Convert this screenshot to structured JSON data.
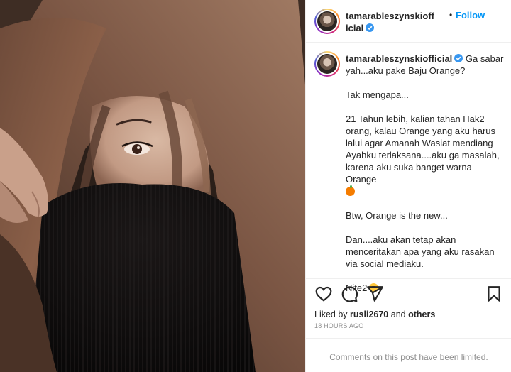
{
  "post": {
    "username": "tamarableszynskiofficial",
    "follow_label": "Follow",
    "separator": "•",
    "caption": [
      "Ga sabar yah...aku pake Baju Orange?",
      "Tak mengapa...",
      "21 Tahun lebih, kalian tahan Hak2 orang, kalau Orange yang aku harus lalui agar Amanah Wasiat mendiang Ayahku terlaksana....aku ga masalah, karena aku suka banget warna Orange",
      "Btw, Orange is the new...",
      "Dan....aku akan tetap akan menceritakan apa yang aku rasakan via social mediaku.",
      "Nite2"
    ],
    "liked_by_prefix": "Liked by",
    "liked_by_user": "rusli2670",
    "liked_by_and": "and",
    "liked_by_others": "others",
    "timestamp": "18 HOURS AGO",
    "comments_limited": "Comments on this post have been limited."
  },
  "icons": {
    "verified": "verified-badge-icon",
    "like": "heart-icon",
    "comment": "comment-icon",
    "share": "paper-plane-icon",
    "save": "bookmark-icon",
    "orange_emoji": "tangerine-emoji",
    "face_emoji": "face-emoji"
  },
  "colors": {
    "accent": "#0095f6",
    "verified": "#3897f0",
    "text": "#262626",
    "muted": "#8e8e8e",
    "border": "#efefef"
  }
}
